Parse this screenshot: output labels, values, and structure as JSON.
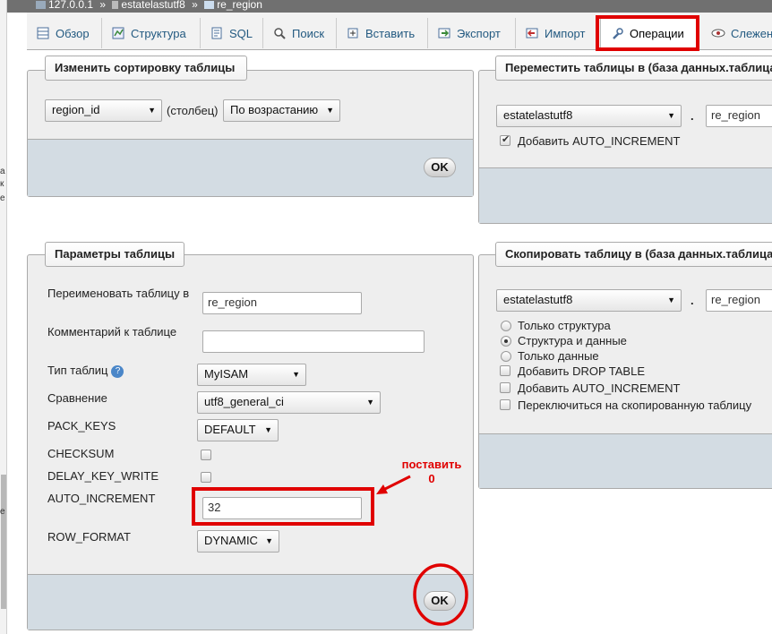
{
  "breadcrumb": {
    "server": "127.0.0.1",
    "database": "estatelastutf8",
    "table": "re_region",
    "separator": "»"
  },
  "tabs": [
    {
      "label": "Обзор",
      "icon": "browse-icon"
    },
    {
      "label": "Структура",
      "icon": "structure-icon"
    },
    {
      "label": "SQL",
      "icon": "sql-icon"
    },
    {
      "label": "Поиск",
      "icon": "search-icon"
    },
    {
      "label": "Вставить",
      "icon": "insert-icon"
    },
    {
      "label": "Экспорт",
      "icon": "export-icon"
    },
    {
      "label": "Импорт",
      "icon": "import-icon"
    },
    {
      "label": "Операции",
      "icon": "wrench-icon",
      "active": true
    },
    {
      "label": "Слежени",
      "icon": "eye-icon"
    }
  ],
  "sort": {
    "legend": "Изменить сортировку таблицы",
    "column_value": "region_id",
    "column_label": "(столбец)",
    "order_value": "По возрастанию",
    "ok": "OK"
  },
  "move": {
    "legend": "Переместить таблицы в (база данных.таблица",
    "db_value": "estatelastutf8",
    "dot": ".",
    "table_value": "re_region",
    "auto_increment_label": "Добавить AUTO_INCREMENT"
  },
  "params": {
    "legend": "Параметры таблицы",
    "rename_label": "Переименовать таблицу в",
    "rename_value": "re_region",
    "comment_label": "Комментарий к таблице",
    "comment_value": "",
    "type_label": "Тип таблиц",
    "type_value": "MyISAM",
    "collation_label": "Сравнение",
    "collation_value": "utf8_general_ci",
    "pack_keys_label": "PACK_KEYS",
    "pack_keys_value": "DEFAULT",
    "checksum_label": "CHECKSUM",
    "delay_key_write_label": "DELAY_KEY_WRITE",
    "auto_increment_label": "AUTO_INCREMENT",
    "auto_increment_value": "32",
    "row_format_label": "ROW_FORMAT",
    "row_format_value": "DYNAMIC",
    "ok": "OK"
  },
  "copy": {
    "legend": "Скопировать таблицу в (база данных.таблица",
    "db_value": "estatelastutf8",
    "dot": ".",
    "table_value": "re_region",
    "opt_structure": "Только структура",
    "opt_structure_data": "Структура и данные",
    "opt_data": "Только данные",
    "drop_table": "Добавить DROP TABLE",
    "auto_increment": "Добавить AUTO_INCREMENT",
    "switch_to_copy": "Переключиться на скопированную таблицу"
  },
  "annotation": {
    "line1": "поставить",
    "line2": "0"
  },
  "colors": {
    "highlight": "#e00000",
    "footer": "#d3dce3",
    "fieldset": "#eeeeee"
  }
}
